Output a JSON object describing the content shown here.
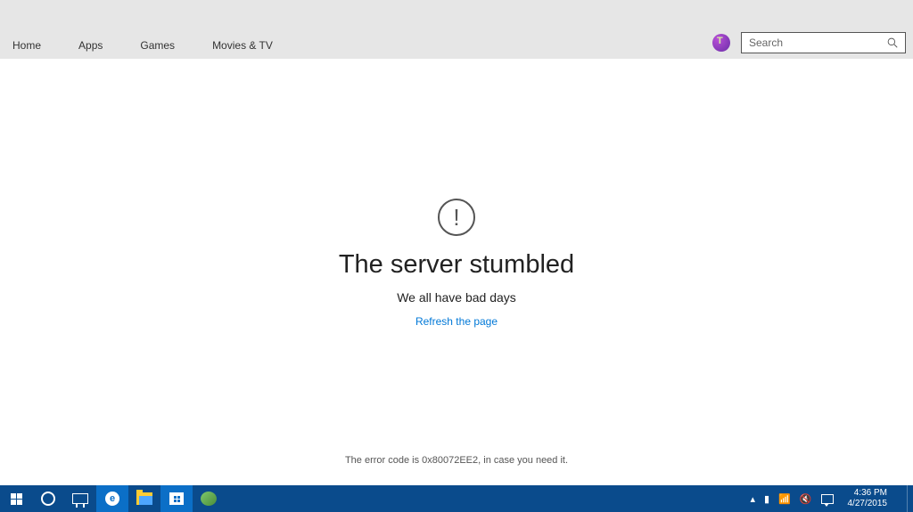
{
  "nav": {
    "items": [
      "Home",
      "Apps",
      "Games",
      "Movies & TV"
    ]
  },
  "search": {
    "placeholder": "Search"
  },
  "error": {
    "exclamation": "!",
    "title": "The server stumbled",
    "subtitle": "We all have bad days",
    "refresh": "Refresh the page",
    "code": "The error code is 0x80072EE2, in case you need it."
  },
  "tray": {
    "up": "▴",
    "battery": "▮",
    "wifi": "📶",
    "sound": "🔇"
  },
  "clock": {
    "time": "4:36 PM",
    "date": "4/27/2015"
  }
}
